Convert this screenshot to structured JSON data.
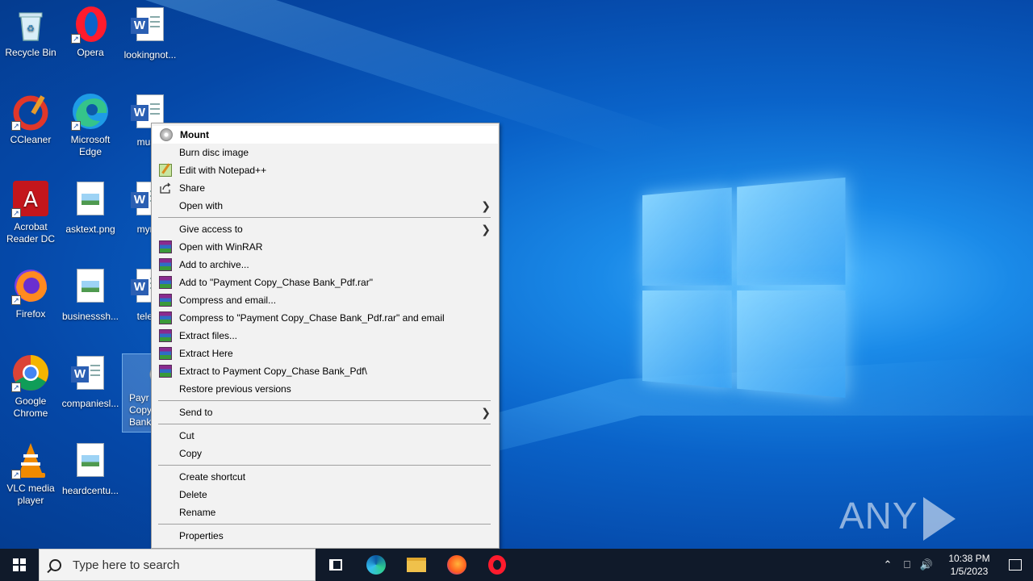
{
  "desktop": {
    "icons": [
      {
        "label": "Recycle Bin",
        "icon": "recycle-bin-icon"
      },
      {
        "label": "Opera",
        "icon": "opera-icon"
      },
      {
        "label": "lookingnot...",
        "icon": "word-document-icon"
      },
      {
        "label": "CCleaner",
        "icon": "ccleaner-icon"
      },
      {
        "label": "Microsoft Edge",
        "icon": "edge-icon"
      },
      {
        "label": "musta",
        "icon": "word-document-icon"
      },
      {
        "label": "Acrobat Reader DC",
        "icon": "acrobat-icon"
      },
      {
        "label": "asktext.png",
        "icon": "image-file-icon"
      },
      {
        "label": "myma",
        "icon": "word-document-icon"
      },
      {
        "label": "Firefox",
        "icon": "firefox-icon"
      },
      {
        "label": "businesssh...",
        "icon": "image-file-icon"
      },
      {
        "label": "teleph",
        "icon": "word-document-icon"
      },
      {
        "label": "Google Chrome",
        "icon": "chrome-icon"
      },
      {
        "label": "companiesl...",
        "icon": "word-document-icon"
      },
      {
        "label": "Payr Copy_ Bank_P",
        "icon": "disc-image-icon"
      },
      {
        "label": "VLC media player",
        "icon": "vlc-icon"
      },
      {
        "label": "heardcentu...",
        "icon": "image-file-icon"
      }
    ]
  },
  "context_menu": {
    "mount": "Mount",
    "burn": "Burn disc image",
    "notepad": "Edit with Notepad++",
    "share": "Share",
    "open_with": "Open with",
    "give_access": "Give access to",
    "open_winrar": "Open with WinRAR",
    "add_archive": "Add to archive...",
    "add_to_rar": "Add to \"Payment Copy_Chase Bank_Pdf.rar\"",
    "compress_email": "Compress and email...",
    "compress_to_rar_email": "Compress to \"Payment Copy_Chase Bank_Pdf.rar\" and email",
    "extract_files": "Extract files...",
    "extract_here": "Extract Here",
    "extract_to": "Extract to Payment Copy_Chase Bank_Pdf\\",
    "restore": "Restore previous versions",
    "send_to": "Send to",
    "cut": "Cut",
    "copy": "Copy",
    "create_shortcut": "Create shortcut",
    "delete": "Delete",
    "rename": "Rename",
    "properties": "Properties"
  },
  "watermark": {
    "left": "ANY",
    "right": "RUN"
  },
  "taskbar": {
    "search_placeholder": "Type here to search",
    "time": "10:38 PM",
    "date": "1/5/2023"
  }
}
